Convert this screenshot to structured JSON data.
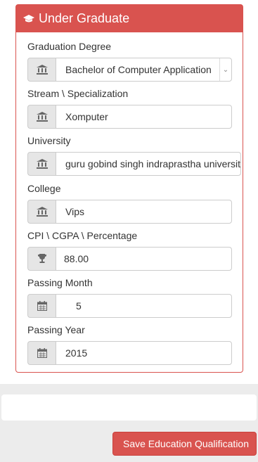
{
  "panel": {
    "title": "Under Graduate"
  },
  "fields": {
    "degree": {
      "label": "Graduation Degree",
      "value": "Bachelor of Computer Application",
      "icon": "bank-icon"
    },
    "stream": {
      "label": "Stream \\ Specialization",
      "value": "Xomputer",
      "icon": "bank-icon"
    },
    "university": {
      "label": "University",
      "value": "guru gobind singh indraprastha university",
      "icon": "bank-icon"
    },
    "college": {
      "label": "College",
      "value": "Vips",
      "icon": "bank-icon"
    },
    "cgpa": {
      "label": "CPI \\ CGPA \\ Percentage",
      "value": "88.00",
      "icon": "trophy-icon"
    },
    "month": {
      "label": "Passing Month",
      "value": "5",
      "icon": "calendar-icon"
    },
    "year": {
      "label": "Passing Year",
      "value": "2015",
      "icon": "calendar-icon"
    }
  },
  "actions": {
    "save_label": "Save Education Qualification"
  },
  "colors": {
    "accent": "#d9534f"
  }
}
